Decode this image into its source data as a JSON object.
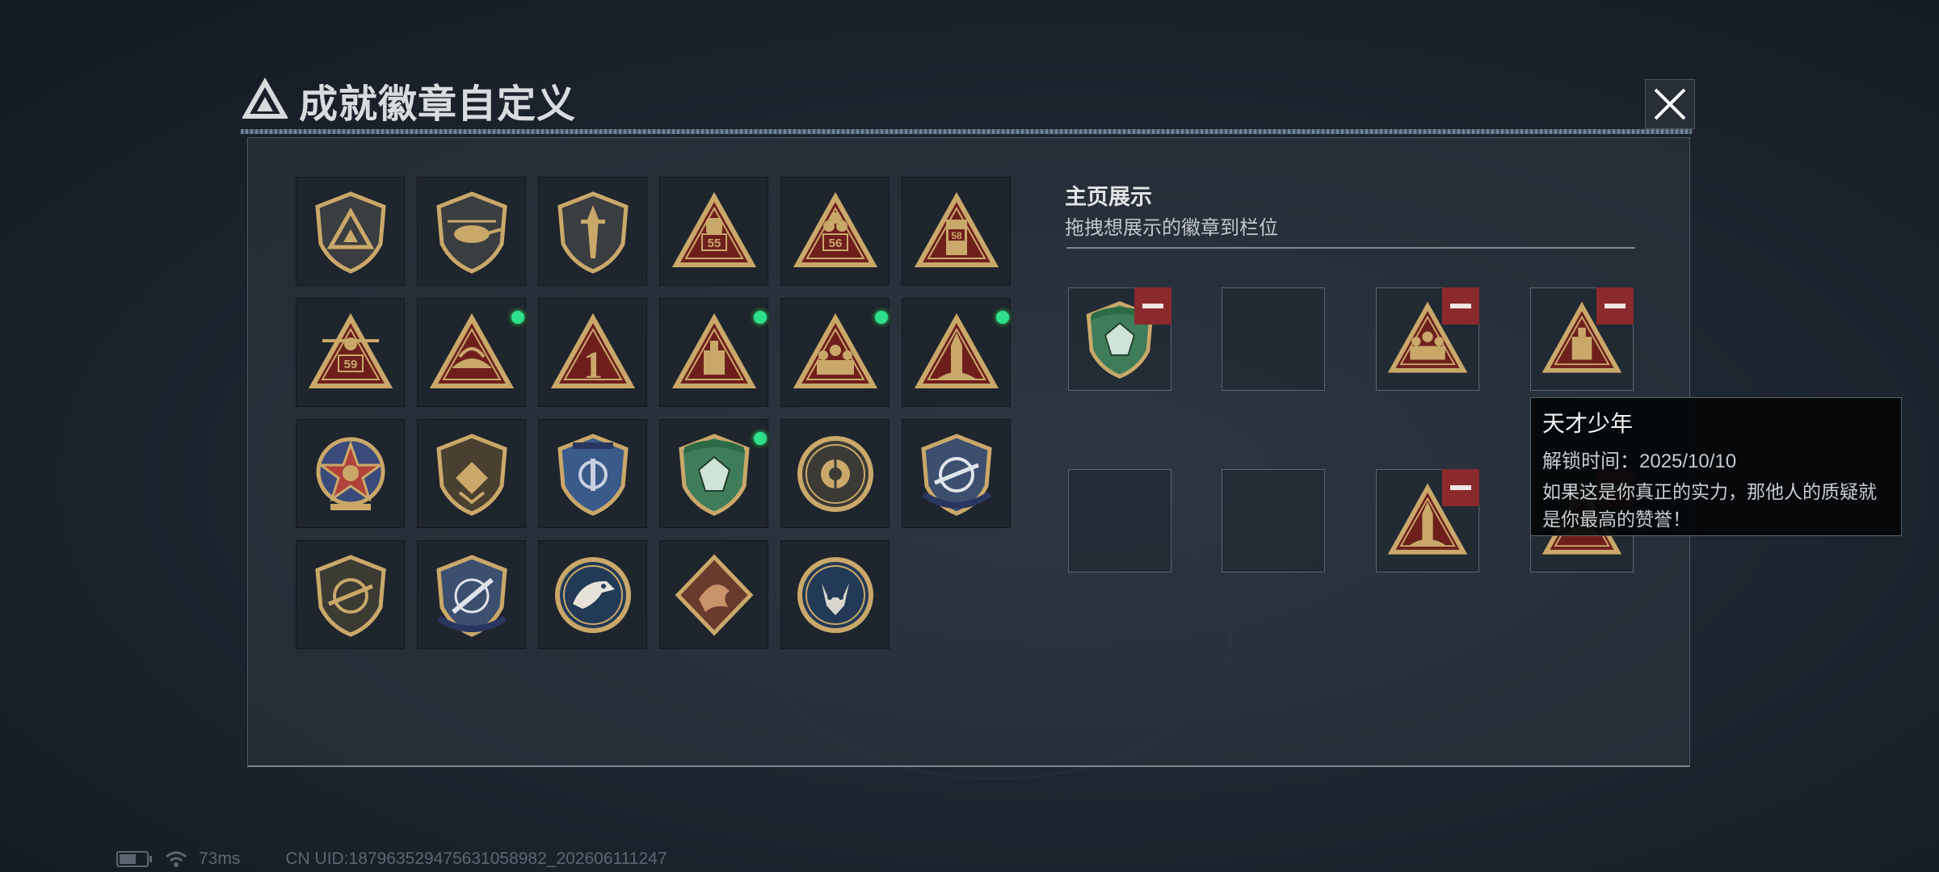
{
  "header": {
    "title": "成就徽章自定义",
    "close_icon": "close-icon"
  },
  "colors": {
    "gold": "#c9a86a",
    "red_dark": "#6e1f1c",
    "green": "#3f7d5a",
    "blue": "#3a5a8a",
    "new_indicator": "#2fe08a",
    "remove_button": "#8a2a2d"
  },
  "badges": [
    {
      "icon": "shield-triangle-badge",
      "new": false
    },
    {
      "icon": "helicopter-shield-badge",
      "new": false
    },
    {
      "icon": "dagger-shield-badge",
      "new": false
    },
    {
      "icon": "backpack-55-triangle-badge",
      "new": false
    },
    {
      "icon": "trio-56-triangle-badge",
      "new": false
    },
    {
      "icon": "locker-58-triangle-badge",
      "new": false
    },
    {
      "icon": "drone-59-triangle-badge",
      "new": false
    },
    {
      "icon": "hat-triangle-badge",
      "new": true
    },
    {
      "icon": "number-one-triangle-badge",
      "new": false
    },
    {
      "icon": "crate-triangle-badge",
      "new": true
    },
    {
      "icon": "squad-triangle-badge",
      "new": true
    },
    {
      "icon": "rocket-triangle-badge",
      "new": true
    },
    {
      "icon": "star-emblem-badge",
      "new": false
    },
    {
      "icon": "gold-shield-badge",
      "new": false
    },
    {
      "icon": "blue-wing-shield-badge",
      "new": false
    },
    {
      "icon": "green-gem-shield-badge",
      "new": true
    },
    {
      "icon": "crosshair-round-badge",
      "new": false
    },
    {
      "icon": "rifle-crosshair-blue-badge",
      "new": false
    },
    {
      "icon": "rifle-crosshair-gold-badge",
      "new": false
    },
    {
      "icon": "sword-wing-blue-badge",
      "new": false
    },
    {
      "icon": "eagle-round-badge",
      "new": false
    },
    {
      "icon": "dragon-diamond-badge",
      "new": false
    },
    {
      "icon": "wolf-round-badge",
      "new": false
    }
  ],
  "showcase": {
    "title": "主页展示",
    "subtitle": "拖拽想展示的徽章到栏位",
    "slots": [
      {
        "icon": "green-gem-shield-badge",
        "filled": true
      },
      {
        "icon": "",
        "filled": false
      },
      {
        "icon": "squad-triangle-badge",
        "filled": true
      },
      {
        "icon": "crate-triangle-badge",
        "filled": true
      },
      {
        "icon": "",
        "filled": false
      },
      {
        "icon": "",
        "filled": false
      },
      {
        "icon": "rocket-triangle-badge",
        "filled": true
      },
      {
        "icon": "hat-triangle-badge",
        "filled": true
      }
    ]
  },
  "tooltip": {
    "name": "天才少年",
    "unlock_time": "解锁时间：2025/10/10",
    "description": "如果这是你真正的实力，那他人的质疑就是你最高的赞誉！"
  },
  "status": {
    "ping": "73ms",
    "uid": "CN UID:1879635294756310589​82_202606111247"
  }
}
